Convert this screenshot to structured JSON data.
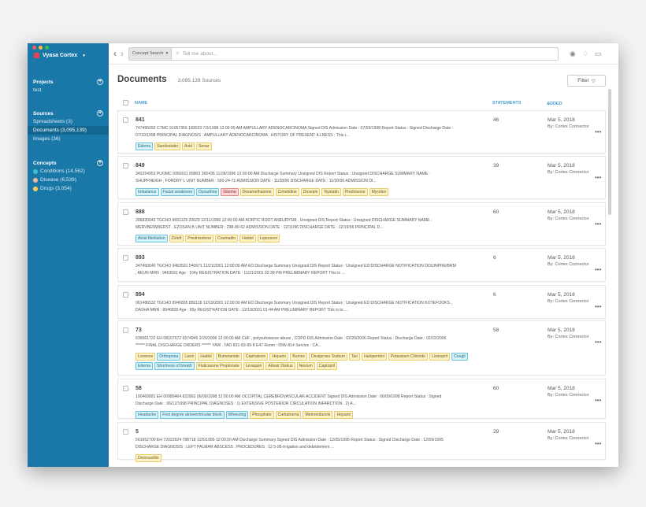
{
  "app": {
    "name": "Vyasa Cortex"
  },
  "sidebar": {
    "projects": {
      "title": "Projects",
      "items": [
        {
          "label": "test"
        }
      ]
    },
    "sources": {
      "title": "Sources",
      "items": [
        {
          "label": "Spreadsheets (3)"
        },
        {
          "label": "Documents (3,095,139)",
          "active": true
        },
        {
          "label": "Images (36)"
        }
      ]
    },
    "concepts": {
      "title": "Concepts",
      "items": [
        {
          "label": "Conditions (14,562)",
          "color": "#3fc1d6"
        },
        {
          "label": "Disease (6,539)",
          "color": "#f2b8a6"
        },
        {
          "label": "Drugs (3,054)",
          "color": "#f3d15a"
        }
      ]
    }
  },
  "topbar": {
    "search_select": "Concept Search",
    "search_placeholder": "Tell me about..."
  },
  "header": {
    "title": "Documents",
    "count": "3,095,139 Sources",
    "filter_label": "Filter"
  },
  "columns": {
    "name": "NAME",
    "statements": "STATEMENTS",
    "added": "ADDED"
  },
  "documents": [
    {
      "id": "841",
      "lines": [
        "747495092 CTMC 91057356 183023 7/3/1998 12:00:00 AM AMPULLARY ADENOCARCINOMA Signed DIS Admission Date : 07/03/1998 Report Status : Signed Discharge Date :",
        "07/10/1998 PRINCIPAL DIAGNOSIS : AMPULLARY ADENOCARCINOMA . HISTORY OF PRESENT ILLNESS : This i..."
      ],
      "tags": [
        {
          "t": "Edema",
          "c": "b"
        },
        {
          "t": "Sandostatin",
          "c": "y"
        },
        {
          "t": "Axid",
          "c": "y"
        },
        {
          "t": "Senar",
          "c": "y"
        }
      ],
      "statements": "46",
      "date": "Mar 5, 2018",
      "by": "By: Cortex Connector"
    },
    {
      "id": "849",
      "lines": [
        "343254953 PUOMC 6950011 89803 365436 11/28/1996 12:00:00 AM Discharge Summary Unsigned DIS Report Status : Unsigned DISCHARGE SUMMARY NAME :",
        "SHUPFNEIGH , FORDRY L UNIT NUMBER : 560-24-71 ADMISSION DATE : 11/28/96 DISCHARGE DATE : 11/30/96 ADMISSION DI..."
      ],
      "tags": [
        {
          "t": "Imbalance",
          "c": "b"
        },
        {
          "t": "Facial weakness",
          "c": "b"
        },
        {
          "t": "Dysarthria",
          "c": "b"
        },
        {
          "t": "Glioma",
          "c": "r"
        },
        {
          "t": "Dexamethasone",
          "c": "y"
        },
        {
          "t": "Cimetidine",
          "c": "y"
        },
        {
          "t": "Doxepin",
          "c": "y"
        },
        {
          "t": "Nystatin",
          "c": "y"
        },
        {
          "t": "Prednisone",
          "c": "y"
        },
        {
          "t": "Mycelex",
          "c": "y"
        }
      ],
      "statements": "39",
      "date": "Mar 5, 2018",
      "by": "By: Cortex Connector"
    },
    {
      "id": "888",
      "lines": [
        "286830043 TGCHO 8651129 20629 12/11/1996 12:00:00 AM AORTIC ROOT ANEURYSM . Unsigned DIS Report Status : Unsigned DISCHARGE SUMMARY NAME :",
        "MERVBENWIERST , EZOSAN B UNIT NUMBER : 298-80-62 ADMISSION DATE : 12/11/96 DISCHARGE DATE : 12/19/96 PRINCIPAL D..."
      ],
      "tags": [
        {
          "t": "Atrial fibrillation",
          "c": "b"
        },
        {
          "t": "Zoloft",
          "c": "y"
        },
        {
          "t": "Prednisolone",
          "c": "y"
        },
        {
          "t": "Coumadin",
          "c": "y"
        },
        {
          "t": "Haldol",
          "c": "y"
        },
        {
          "t": "Lopressor",
          "c": "y"
        }
      ],
      "statements": "60",
      "date": "Mar 5, 2018",
      "by": "By: Cortex Connector"
    },
    {
      "id": "893",
      "lines": [
        "347450640 TGCHO 9463591 540671 11/21/2001 12:00:00 AM ED Discharge Summary Unsigned DIS Report Status : Unsigned ED DISCHARGE NOTIFICATION DOUINPREIBRM",
        ", AEUN MRN : 9463591 Age : 104y REGISTRATION DATE : 11/21/2001 02:38 PM PRELIMINARY REPORT This is ..."
      ],
      "tags": [],
      "statements": "6",
      "date": "Mar 5, 2018",
      "by": "By: Cortex Connector"
    },
    {
      "id": "894",
      "lines": [
        "061486532 TGCHO 8946835 850116 12/19/2001 12:00:00 AM ED Discharge Summary Unsigned DIS Report Status : Unsigned ED DISCHARGE NOTIFICATION KOTEFOOKS ,",
        "DASHA MRN : 8946835 Age : 89y REGISTRATION DATE : 12/19/2001 01:44 AM PRELIMINARY REPORT This is to ..."
      ],
      "tags": [],
      "statements": "6",
      "date": "Mar 5, 2018",
      "by": "By: Cortex Connector"
    },
    {
      "id": "73",
      "lines": [
        "639561722 EH 08107672 6574945 2/20/2006 12:00:00 AM CHF , polysubstance abuse , COPD DIS Admission Date : 02/20/2006 Report Status : Discharge Date : 02/22/2006",
        "****** FINAL DISCHARGE ORDERS ****** YAW , TAO 831-83-99-8 E47 Room : 05W-814 Service : CA..."
      ],
      "tags": [
        {
          "t": "Lovenox",
          "c": "y"
        },
        {
          "t": "Orthopnea",
          "c": "b"
        },
        {
          "t": "Lasix",
          "c": "y"
        },
        {
          "t": "Haldol",
          "c": "y"
        },
        {
          "t": "Bumetanide",
          "c": "y"
        },
        {
          "t": "Cephalexin",
          "c": "y"
        },
        {
          "t": "Heparin",
          "c": "y"
        },
        {
          "t": "Bumex",
          "c": "y"
        },
        {
          "t": "Divalproex Sodium",
          "c": "y"
        },
        {
          "t": "Tao",
          "c": "y"
        },
        {
          "t": "Haloperidol",
          "c": "y"
        },
        {
          "t": "Potassium Chloride",
          "c": "y"
        },
        {
          "t": "Lisinopril",
          "c": "y"
        },
        {
          "t": "Cough",
          "c": "b"
        },
        {
          "t": "Edema",
          "c": "b"
        },
        {
          "t": "Shortness of breath",
          "c": "b"
        },
        {
          "t": "Fluticasone Propionate",
          "c": "y"
        },
        {
          "t": "Levaquin",
          "c": "y"
        },
        {
          "t": "Advair Diskus",
          "c": "y"
        },
        {
          "t": "Nexium",
          "c": "y"
        },
        {
          "t": "Captopril",
          "c": "y"
        }
      ],
      "statements": "58",
      "date": "Mar 5, 2018",
      "by": "By: Cortex Connector"
    },
    {
      "id": "58",
      "lines": [
        "100469881 EH 00989464 822862 06/09/1998 12:00:00 AM OCCIPITAL CEREBROVASCULAR ACCIDENT Signed DIS Admission Date : 06/09/1998 Report Status : Signed",
        "Discharge Date : 06/12/1998 PRINCIPAL DIAGNOSES : 1) EXTENSIVE POSTERIOR CIRCULATION INFARCTION . 2) A..."
      ],
      "tags": [
        {
          "t": "Headache",
          "c": "b"
        },
        {
          "t": "First degree atrioventricular block",
          "c": "b"
        },
        {
          "t": "Wheezing",
          "c": "b"
        },
        {
          "t": "Phosphate",
          "c": "y"
        },
        {
          "t": "Carbatrama",
          "c": "y"
        },
        {
          "t": "Metronidazole",
          "c": "y"
        },
        {
          "t": "Heparin",
          "c": "y"
        }
      ],
      "statements": "60",
      "date": "Mar 5, 2018",
      "by": "By: Cortex Connector"
    },
    {
      "id": "5",
      "lines": [
        "561652700 EH 72023524 788718 12/5/1995 12:00:00 AM Discharge Summary Signed DIS Admission Date : 12/05/1995 Report Status : Signed Discharge Date : 12/09/1995",
        "DISCHARGE DIAGNOSIS : LEFT PALMAR ABSCESS . PROCEDURES : 12 5-95-irrigation and debridement ..."
      ],
      "tags": [
        {
          "t": "Dicloxacillin",
          "c": "y"
        }
      ],
      "statements": "29",
      "date": "Mar 5, 2018",
      "by": "By: Cortex Connector"
    }
  ]
}
